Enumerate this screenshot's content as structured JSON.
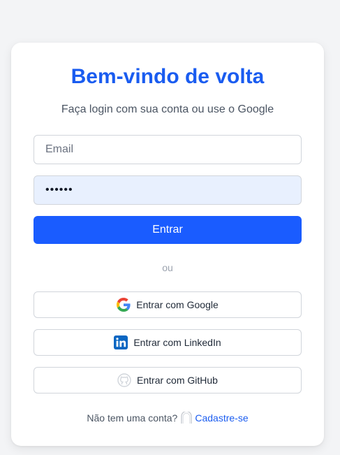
{
  "login": {
    "title": "Bem-vindo de volta",
    "subtitle": "Faça login com sua conta ou use o Google",
    "email_placeholder": "Email",
    "email_value": "",
    "password_value": "123456",
    "submit_label": "Entrar",
    "divider_label": "ou",
    "google_label": "Entrar com Google",
    "linkedin_label": "Entrar com LinkedIn",
    "github_label": "Entrar com GitHub",
    "footer_text": "Não tem uma conta?",
    "signup_link": "Cadastre-se"
  },
  "icons": {
    "google": "google-icon",
    "linkedin": "linkedin-icon",
    "github": "github-icon",
    "signup": "broken-image-icon"
  },
  "colors": {
    "accent": "#1a5cff",
    "title": "#1a5cf0",
    "background": "#f3f4f6",
    "card": "#ffffff",
    "password_autofill": "#e8f0fe",
    "linkedin": "#0a66c2"
  }
}
